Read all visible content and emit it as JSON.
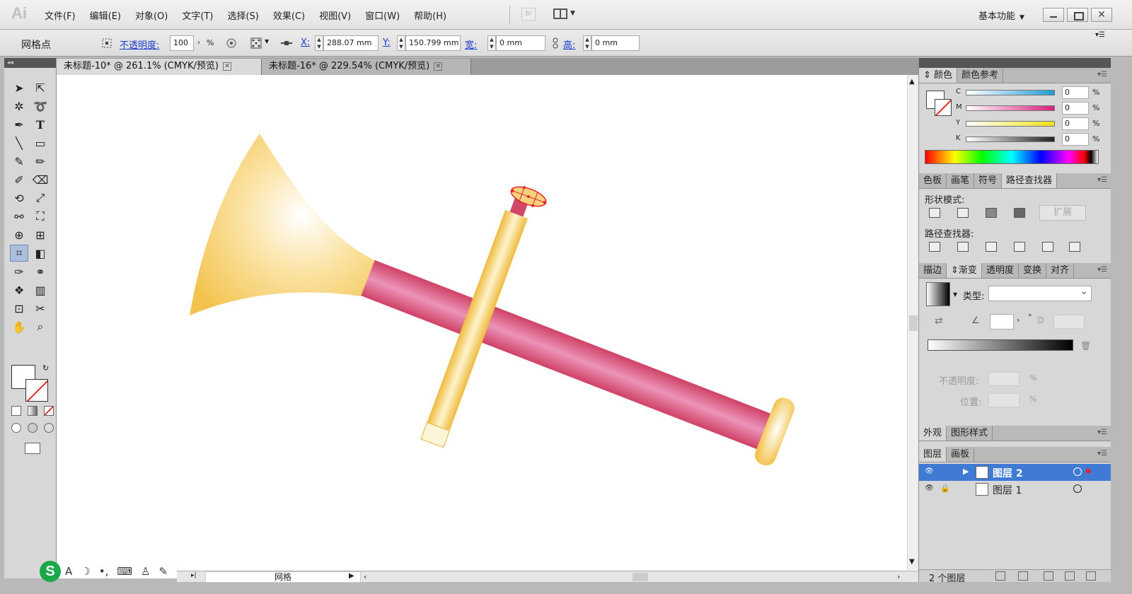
{
  "app": {
    "logo": "Ai"
  },
  "menu": [
    "文件(F)",
    "编辑(E)",
    "对象(O)",
    "文字(T)",
    "选择(S)",
    "效果(C)",
    "视图(V)",
    "窗口(W)",
    "帮助(H)"
  ],
  "bridge_label": "Br",
  "workspace": {
    "label": "基本功能"
  },
  "window_controls": {
    "close_glyph": "✕"
  },
  "control_bar": {
    "selection_label": "网格点",
    "opacity_label": "不透明度:",
    "opacity_value": "100",
    "opacity_unit": "%",
    "x_label": "X:",
    "x_value": "288.07 mm",
    "y_label": "Y:",
    "y_value": "150.799 mm",
    "w_label": "宽:",
    "w_value": "0 mm",
    "h_label": "高:",
    "h_value": "0 mm"
  },
  "tabs": [
    {
      "label": "未标题-10* @ 261.1% (CMYK/预览)",
      "active": true
    },
    {
      "label": "未标题-16* @ 229.54% (CMYK/预览)",
      "active": false
    }
  ],
  "status_bar": {
    "field": "网格"
  },
  "ime": {
    "logo": "S",
    "items": [
      "A",
      "☽",
      "•,",
      "⌨",
      "♙",
      "✎"
    ]
  },
  "color_panel": {
    "tabs": [
      "颜色",
      "颜色参考"
    ],
    "channels": [
      {
        "label": "C",
        "value": "0",
        "color": "#1f9bd7"
      },
      {
        "label": "M",
        "value": "0",
        "color": "#d6207e"
      },
      {
        "label": "Y",
        "value": "0",
        "color": "#f0e11a"
      },
      {
        "label": "K",
        "value": "0",
        "color": "#222222"
      }
    ],
    "unit": "%"
  },
  "pathfinder_panel": {
    "tabs": [
      "色板",
      "画笔",
      "符号",
      "路径查找器"
    ],
    "shape_modes_label": "形状模式:",
    "pathfinders_label": "路径查找器:",
    "expand_label": "扩展"
  },
  "gradient_panel": {
    "tabs": [
      "描边",
      "渐变",
      "透明度",
      "变换",
      "对齐"
    ],
    "type_label": "类型:",
    "degree": "°",
    "opacity_label": "不透明度:",
    "position_label": "位置:",
    "unit": "%"
  },
  "appearance_panel": {
    "tabs": [
      "外观",
      "图形样式"
    ]
  },
  "layers_panel": {
    "tabs": [
      "图层",
      "画板"
    ],
    "layers": [
      {
        "name": "图层 2",
        "selected": true
      },
      {
        "name": "图层 1",
        "selected": false
      }
    ],
    "count": "2 个图层"
  },
  "colors": {
    "selection": "#3f7bd5",
    "bell": "#f5c94c",
    "tube": "#d44d6e",
    "rod": "#f0c24a"
  }
}
